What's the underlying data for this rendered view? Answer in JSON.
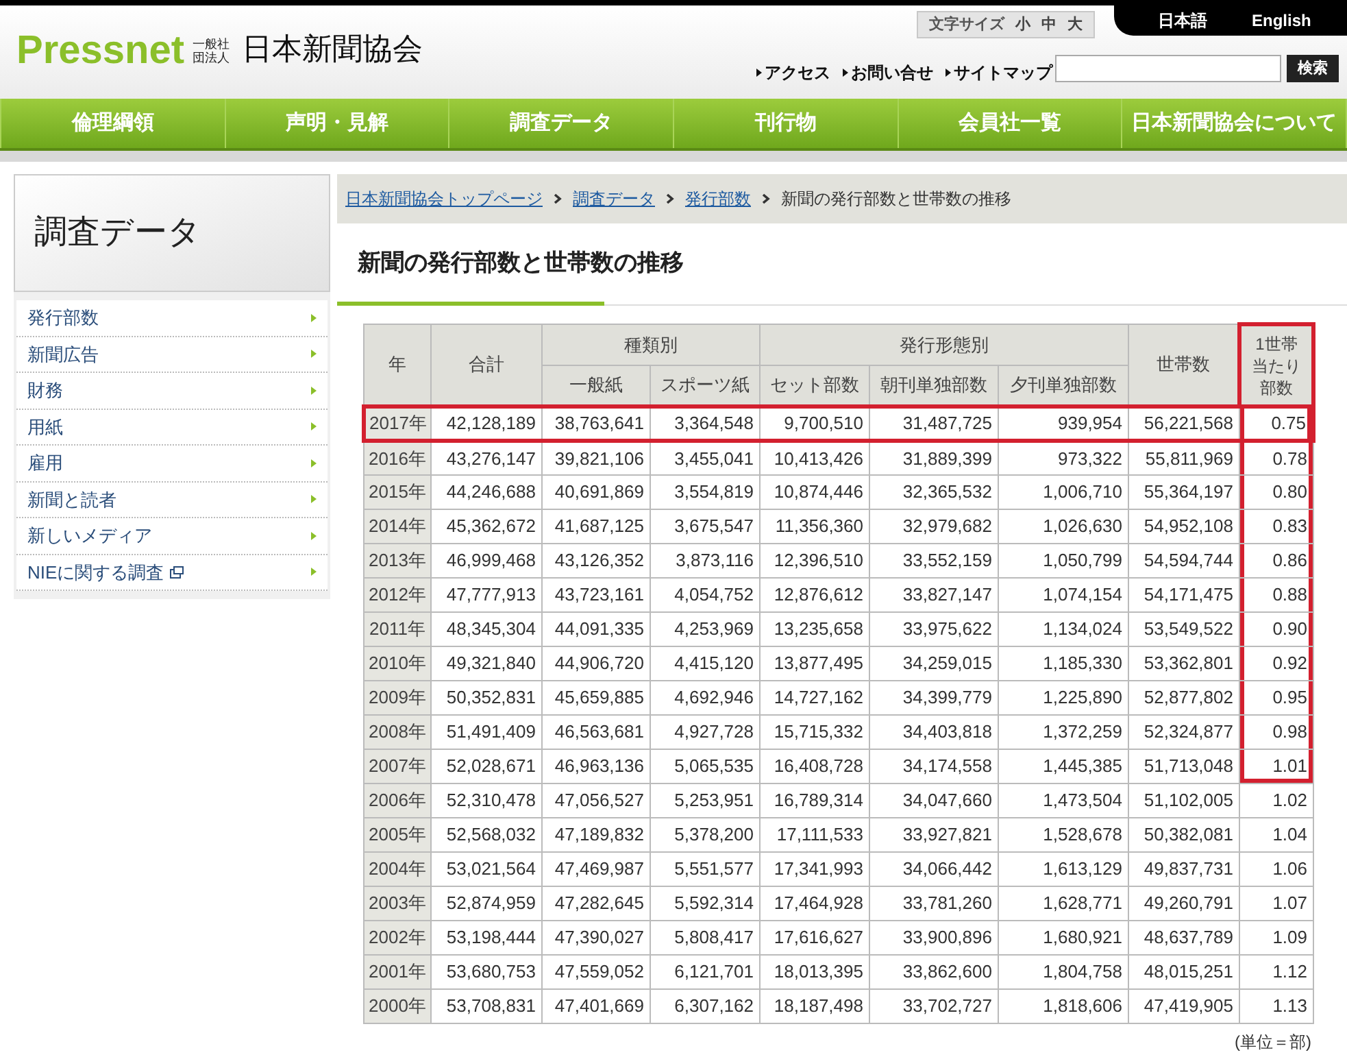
{
  "header": {
    "logo_text": "Pressnet",
    "org_type": "一般社団法人",
    "org_name": "日本新聞協会",
    "font_size": {
      "label": "文字サイズ",
      "options": [
        "小",
        "中",
        "大"
      ]
    },
    "languages": [
      "日本語",
      "English"
    ],
    "links": [
      "アクセス",
      "お問い合せ",
      "サイトマップ"
    ],
    "search_button": "検索"
  },
  "nav": [
    "倫理綱領",
    "声明・見解",
    "調査データ",
    "刊行物",
    "会員社一覧",
    "日本新聞協会について"
  ],
  "sidebar": {
    "title": "調査データ",
    "items": [
      {
        "label": "発行部数",
        "external": false
      },
      {
        "label": "新聞広告",
        "external": false
      },
      {
        "label": "財務",
        "external": false
      },
      {
        "label": "用紙",
        "external": false
      },
      {
        "label": "雇用",
        "external": false
      },
      {
        "label": "新聞と読者",
        "external": false
      },
      {
        "label": "新しいメディア",
        "external": false
      },
      {
        "label": "NIEに関する調査",
        "external": true
      }
    ]
  },
  "breadcrumb": [
    {
      "label": "日本新聞協会トップページ",
      "link": true
    },
    {
      "label": "調査データ",
      "link": true
    },
    {
      "label": "発行部数",
      "link": true
    },
    {
      "label": "新聞の発行部数と世帯数の推移",
      "link": false
    }
  ],
  "page_title": "新聞の発行部数と世帯数の推移",
  "table": {
    "header": {
      "year": "年",
      "total": "合計",
      "by_type": {
        "label": "種類別",
        "columns": [
          "一般紙",
          "スポーツ紙"
        ]
      },
      "by_form": {
        "label": "発行形態別",
        "columns": [
          "セット部数",
          "朝刊単独部数",
          "夕刊単独部数"
        ]
      },
      "households": "世帯数",
      "per_household": {
        "lines": [
          "1世帯",
          "当たり",
          "部数"
        ],
        "highlighted": true
      }
    },
    "rows": [
      {
        "year": "2017年",
        "cells": [
          "42,128,189",
          "38,763,641",
          "3,364,548",
          "9,700,510",
          "31,487,725",
          "939,954",
          "56,221,568",
          "0.75"
        ],
        "row_highlighted": true,
        "ratio_highlighted": true
      },
      {
        "year": "2016年",
        "cells": [
          "43,276,147",
          "39,821,106",
          "3,455,041",
          "10,413,426",
          "31,889,399",
          "973,322",
          "55,811,969",
          "0.78"
        ],
        "row_highlighted": false,
        "ratio_highlighted": true
      },
      {
        "year": "2015年",
        "cells": [
          "44,246,688",
          "40,691,869",
          "3,554,819",
          "10,874,446",
          "32,365,532",
          "1,006,710",
          "55,364,197",
          "0.80"
        ],
        "row_highlighted": false,
        "ratio_highlighted": true
      },
      {
        "year": "2014年",
        "cells": [
          "45,362,672",
          "41,687,125",
          "3,675,547",
          "11,356,360",
          "32,979,682",
          "1,026,630",
          "54,952,108",
          "0.83"
        ],
        "row_highlighted": false,
        "ratio_highlighted": true
      },
      {
        "year": "2013年",
        "cells": [
          "46,999,468",
          "43,126,352",
          "3,873,116",
          "12,396,510",
          "33,552,159",
          "1,050,799",
          "54,594,744",
          "0.86"
        ],
        "row_highlighted": false,
        "ratio_highlighted": true
      },
      {
        "year": "2012年",
        "cells": [
          "47,777,913",
          "43,723,161",
          "4,054,752",
          "12,876,612",
          "33,827,147",
          "1,074,154",
          "54,171,475",
          "0.88"
        ],
        "row_highlighted": false,
        "ratio_highlighted": true
      },
      {
        "year": "2011年",
        "cells": [
          "48,345,304",
          "44,091,335",
          "4,253,969",
          "13,235,658",
          "33,975,622",
          "1,134,024",
          "53,549,522",
          "0.90"
        ],
        "row_highlighted": false,
        "ratio_highlighted": true
      },
      {
        "year": "2010年",
        "cells": [
          "49,321,840",
          "44,906,720",
          "4,415,120",
          "13,877,495",
          "34,259,015",
          "1,185,330",
          "53,362,801",
          "0.92"
        ],
        "row_highlighted": false,
        "ratio_highlighted": true
      },
      {
        "year": "2009年",
        "cells": [
          "50,352,831",
          "45,659,885",
          "4,692,946",
          "14,727,162",
          "34,399,779",
          "1,225,890",
          "52,877,802",
          "0.95"
        ],
        "row_highlighted": false,
        "ratio_highlighted": true
      },
      {
        "year": "2008年",
        "cells": [
          "51,491,409",
          "46,563,681",
          "4,927,728",
          "15,715,332",
          "34,403,818",
          "1,372,259",
          "52,324,877",
          "0.98"
        ],
        "row_highlighted": false,
        "ratio_highlighted": true
      },
      {
        "year": "2007年",
        "cells": [
          "52,028,671",
          "46,963,136",
          "5,065,535",
          "16,408,728",
          "34,174,558",
          "1,445,385",
          "51,713,048",
          "1.01"
        ],
        "row_highlighted": false,
        "ratio_highlighted": true
      },
      {
        "year": "2006年",
        "cells": [
          "52,310,478",
          "47,056,527",
          "5,253,951",
          "16,789,314",
          "34,047,660",
          "1,473,504",
          "51,102,005",
          "1.02"
        ],
        "row_highlighted": false,
        "ratio_highlighted": false
      },
      {
        "year": "2005年",
        "cells": [
          "52,568,032",
          "47,189,832",
          "5,378,200",
          "17,111,533",
          "33,927,821",
          "1,528,678",
          "50,382,081",
          "1.04"
        ],
        "row_highlighted": false,
        "ratio_highlighted": false
      },
      {
        "year": "2004年",
        "cells": [
          "53,021,564",
          "47,469,987",
          "5,551,577",
          "17,341,993",
          "34,066,442",
          "1,613,129",
          "49,837,731",
          "1.06"
        ],
        "row_highlighted": false,
        "ratio_highlighted": false
      },
      {
        "year": "2003年",
        "cells": [
          "52,874,959",
          "47,282,645",
          "5,592,314",
          "17,464,928",
          "33,781,260",
          "1,628,771",
          "49,260,791",
          "1.07"
        ],
        "row_highlighted": false,
        "ratio_highlighted": false
      },
      {
        "year": "2002年",
        "cells": [
          "53,198,444",
          "47,390,027",
          "5,808,417",
          "17,616,627",
          "33,900,896",
          "1,680,921",
          "48,637,789",
          "1.09"
        ],
        "row_highlighted": false,
        "ratio_highlighted": false
      },
      {
        "year": "2001年",
        "cells": [
          "53,680,753",
          "47,559,052",
          "6,121,701",
          "18,013,395",
          "33,862,600",
          "1,804,758",
          "48,015,251",
          "1.12"
        ],
        "row_highlighted": false,
        "ratio_highlighted": false
      },
      {
        "year": "2000年",
        "cells": [
          "53,708,831",
          "47,401,669",
          "6,307,162",
          "18,187,498",
          "33,702,727",
          "1,818,606",
          "47,419,905",
          "1.13"
        ],
        "row_highlighted": false,
        "ratio_highlighted": false
      }
    ],
    "unit_note": "(単位＝部)"
  }
}
